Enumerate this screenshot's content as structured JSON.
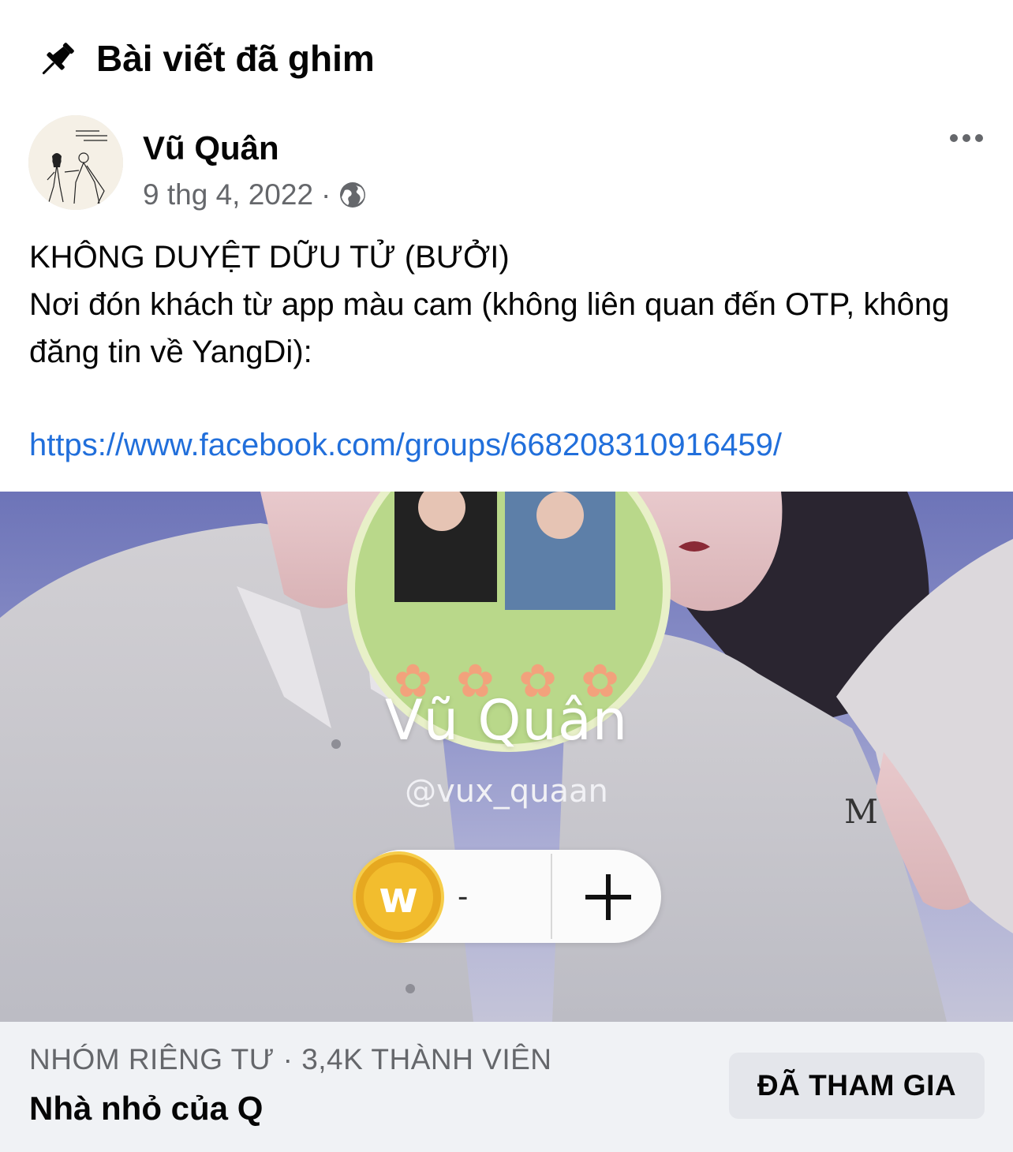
{
  "header": {
    "title": "Bài viết đã ghim",
    "icon": "pin-icon"
  },
  "post": {
    "author": "Vũ Quân",
    "date": "9 thg 4, 2022",
    "separator": "·",
    "privacy_icon": "globe-icon",
    "more_icon": "more-options-icon",
    "lines": [
      "KHÔNG DUYỆT DỮU TỬ (BƯỞI)",
      "Nơi đón khách từ app màu cam (không liên quan đến OTP, không đăng tin về YangDi):"
    ],
    "link": "https://www.facebook.com/groups/668208310916459/"
  },
  "shared_image": {
    "profile_name": "Vũ Quân",
    "handle": "@vux_quaan",
    "wallet_value": "-",
    "coin_icon": "coin-w-icon",
    "add_icon": "plus-icon"
  },
  "group": {
    "meta": "NHÓM RIÊNG TƯ · 3,4K THÀNH VIÊN",
    "name": "Nhà nhỏ của Q",
    "joined_label": "ĐÃ THAM GIA"
  },
  "colors": {
    "link": "#216fdb",
    "secondary_text": "#65676b",
    "footer_bg": "#f0f2f5",
    "button_bg": "#e4e6eb"
  }
}
